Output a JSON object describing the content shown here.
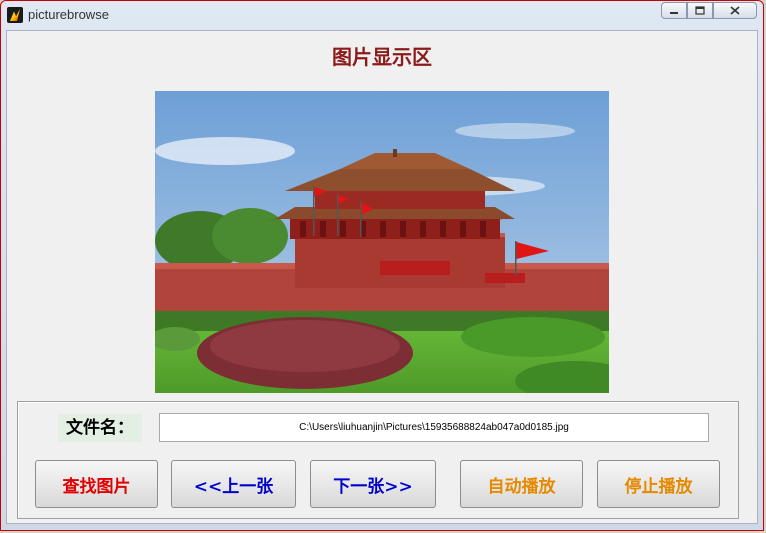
{
  "window": {
    "title": "picturebrowse",
    "icon": "matlab-icon",
    "buttons": {
      "minimize": "minimize-icon",
      "maximize": "maximize-icon",
      "close": "close-icon"
    }
  },
  "main": {
    "heading": "图片显示区",
    "image_alt": "Tiananmen photo"
  },
  "controls": {
    "filename_label": "文件名：",
    "filename_value": "C:\\Users\\liuhuanjin\\Pictures\\15935688824ab047a0d0185.jpg",
    "buttons": [
      {
        "label": "查找图片",
        "color": "#e00000"
      },
      {
        "label": "<<上一张",
        "color": "#0000cc"
      },
      {
        "label": "下一张>>",
        "color": "#0000cc"
      },
      {
        "label": "自动播放",
        "color": "#e58a00"
      },
      {
        "label": "停止播放",
        "color": "#e58a00"
      }
    ]
  },
  "colors": {
    "heading": "#8b1a1a",
    "window_border": "#c80000",
    "client_bg": "#f0f0f0"
  }
}
